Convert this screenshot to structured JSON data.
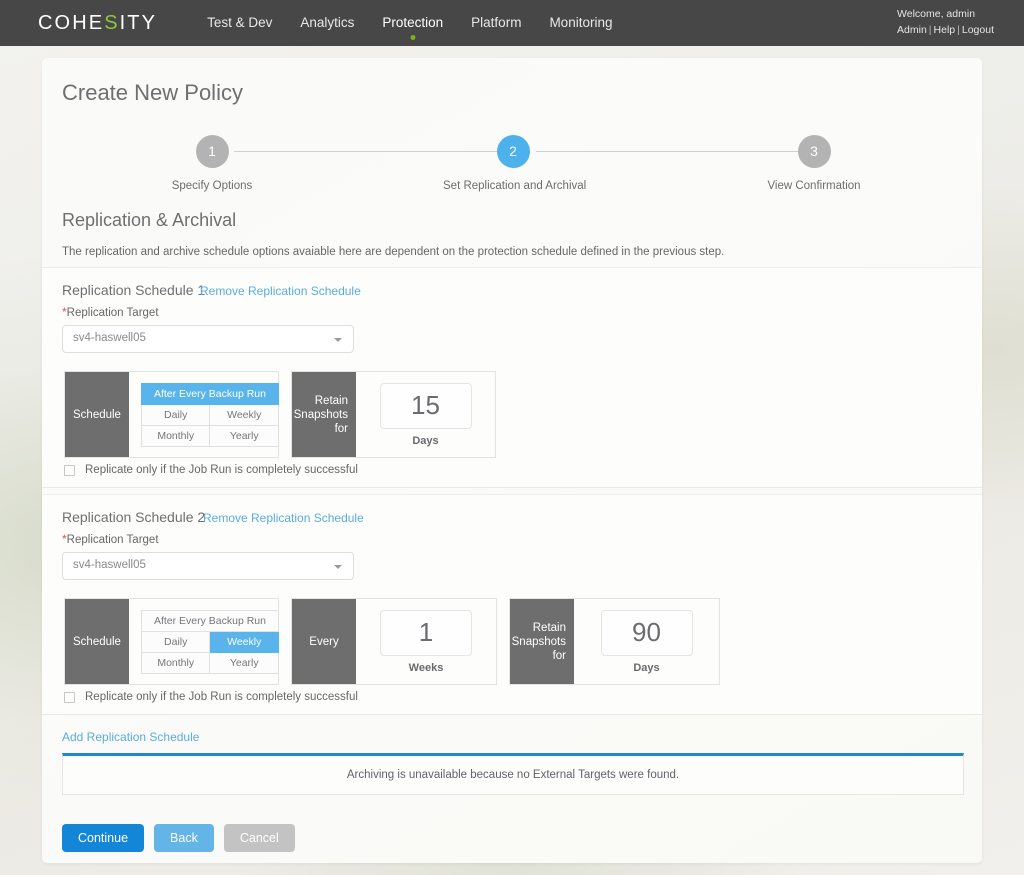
{
  "topbar": {
    "logo": {
      "pre": "COHE",
      "accent": "S",
      "post": "ITY"
    },
    "nav": [
      {
        "label": "Test & Dev",
        "active": false
      },
      {
        "label": "Analytics",
        "active": false
      },
      {
        "label": "Protection",
        "active": true
      },
      {
        "label": "Platform",
        "active": false
      },
      {
        "label": "Monitoring",
        "active": false
      }
    ],
    "welcome": "Welcome, admin",
    "links": {
      "admin": "Admin",
      "help": "Help",
      "logout": "Logout",
      "sep": "|"
    },
    "colors": {
      "bar": "#474747",
      "accent_green": "#8dc63f",
      "active_dot": "#7ab317"
    }
  },
  "page": {
    "title": "Create New Policy"
  },
  "stepper": {
    "steps": [
      {
        "number": "1",
        "label": "Specify Options",
        "state": "inactive"
      },
      {
        "number": "2",
        "label": "Set Replication and Archival",
        "state": "active"
      },
      {
        "number": "3",
        "label": "View Confirmation",
        "state": "inactive"
      }
    ],
    "active_color": "#4db1ec",
    "inactive_color": "#b3b3b3"
  },
  "section": {
    "heading": "Replication & Archival",
    "description": "The replication and archive schedule options avaiable here are dependent on the protection schedule defined in the previous step."
  },
  "schedules": [
    {
      "title": "Replication Schedule 1",
      "remove_label": "Remove Replication Schedule",
      "target_label": "Replication Target",
      "target_required_mark": "*",
      "target_value": "sv4-haswell05",
      "schedule_label": "Schedule",
      "frequency_options": [
        "After Every Backup Run",
        "Daily",
        "Weekly",
        "Monthly",
        "Yearly"
      ],
      "frequency_selected": "After Every Backup Run",
      "every_label": "Every",
      "every_value": "",
      "every_unit": "",
      "every_visible": false,
      "retain_label": "Retain Snapshots for",
      "retain_value": "15",
      "retain_unit": "Days",
      "checkbox_label": "Replicate only if the Job Run is completely successful",
      "checkbox_checked": false
    },
    {
      "title": "Replication Schedule 2",
      "remove_label": "Remove Replication Schedule",
      "target_label": "Replication Target",
      "target_required_mark": "*",
      "target_value": "sv4-haswell05",
      "schedule_label": "Schedule",
      "frequency_options": [
        "After Every Backup Run",
        "Daily",
        "Weekly",
        "Monthly",
        "Yearly"
      ],
      "frequency_selected": "Weekly",
      "every_label": "Every",
      "every_value": "1",
      "every_unit": "Weeks",
      "every_visible": true,
      "retain_label": "Retain Snapshots for",
      "retain_value": "90",
      "retain_unit": "Days",
      "checkbox_label": "Replicate only if the Job Run is completely successful",
      "checkbox_checked": false
    }
  ],
  "add_schedule_label": "Add Replication Schedule",
  "archive_banner": {
    "message": "Archiving is unavailable because no External Targets were found.",
    "border_color": "#1c8ad1"
  },
  "footer": {
    "continue": "Continue",
    "back": "Back",
    "cancel": "Cancel",
    "continue_color": "#1486d8",
    "back_color": "#63b5e8",
    "cancel_color": "#c3c3c3"
  }
}
